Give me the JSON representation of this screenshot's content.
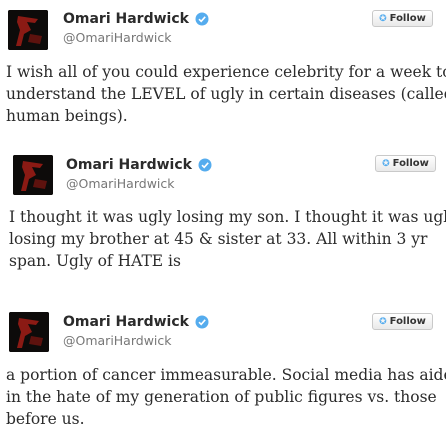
{
  "tweets": [
    {
      "author_name": "Omari Hardwick",
      "handle": "@OmariHardwick",
      "follow_label": "Follow",
      "text_lines": [
        "I wish all of you could experience celebrity for a week to",
        "understand the LEVEL of ugly in certain diseases (called",
        "human beings)."
      ]
    },
    {
      "author_name": "Omari Hardwick",
      "handle": "@OmariHardwick",
      "follow_label": "Follow",
      "text_lines": [
        "I thought it was ugly losing my son. I thought it was ugly",
        "losing my brother at 45 & sister at 33. All within 3 yr",
        "span. Ugly of HATE is"
      ]
    },
    {
      "author_name": "Omari Hardwick",
      "handle": "@OmariHardwick",
      "follow_label": "Follow",
      "text_lines": [
        "a portion of cancer immeasurable. Social media has aided",
        "in the hate of my generation of public figures vs. those",
        "before us."
      ]
    }
  ],
  "icons": {
    "verified": "verified-badge-icon",
    "follow": "twitter-bird-icon"
  },
  "colors": {
    "verified_blue": "#55acee",
    "twitter_blue": "#55acee",
    "avatar_figure": "#8b1a14"
  }
}
